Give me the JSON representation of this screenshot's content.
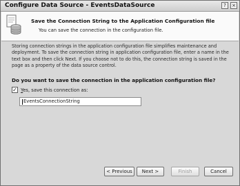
{
  "window": {
    "title": "Configure Data Source - EventsDataSource",
    "help_glyph": "?",
    "close_glyph": "×"
  },
  "header": {
    "title": "Save the Connection String to the Application Configuration file",
    "subtitle": "You can save the connection in the configuration file.",
    "icon": "database-wizard-icon"
  },
  "body": {
    "description": "Storing connection strings in the application configuration file simplifies maintenance and deployment. To save the connection string in application configuration file, enter a name in the text box and then click Next. If you choose not to do this, the connection string is saved in the page as a property of the data source control.",
    "question": "Do you want to save the connection in the application configuration file?",
    "checkbox": {
      "checked": true,
      "check_glyph": "✓",
      "label_accel": "Y",
      "label_rest": "es, save this connection as:"
    },
    "connection_name": "EventsConnectionString"
  },
  "buttons": {
    "previous": "< Previous",
    "next": "Next >",
    "finish": "Finish",
    "cancel": "Cancel"
  },
  "colors": {
    "accent": "#1a1a1a",
    "header_bg": "#fafafa",
    "dialog_bg": "#d8d8d8"
  }
}
